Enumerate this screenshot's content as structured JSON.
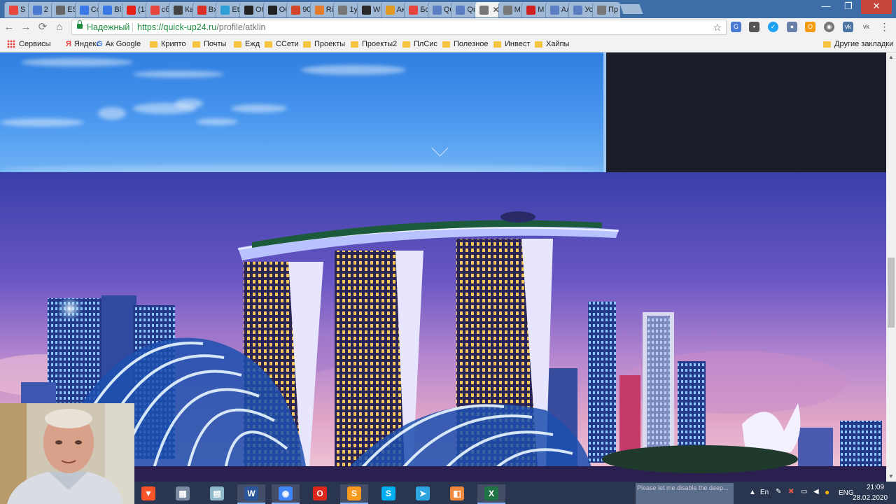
{
  "tabs": [
    {
      "label": "S",
      "icon": "youtube-studio-icon",
      "color": "#e8453c"
    },
    {
      "label": "2",
      "icon": "number-icon",
      "color": "#4a7bd0"
    },
    {
      "label": "ES",
      "icon": "text-icon",
      "color": "#666666"
    },
    {
      "label": "Co",
      "icon": "chat-icon",
      "color": "#3b78e7"
    },
    {
      "label": "Bl",
      "icon": "page-icon",
      "color": "#3b78e7"
    },
    {
      "label": "(13",
      "icon": "youtube-icon",
      "color": "#e62117"
    },
    {
      "label": "сб",
      "icon": "yandex-icon",
      "color": "#e8453c"
    },
    {
      "label": "Ка",
      "icon": "bird-icon",
      "color": "#444444"
    },
    {
      "label": "Вх",
      "icon": "gmail-icon",
      "color": "#d93025"
    },
    {
      "label": "Etl",
      "icon": "wave-icon",
      "color": "#2e9fd8"
    },
    {
      "label": "Об",
      "icon": "bc-icon",
      "color": "#222222"
    },
    {
      "label": "Об",
      "icon": "bc-icon",
      "color": "#222222"
    },
    {
      "label": "90",
      "icon": "mail-icon",
      "color": "#d4462a"
    },
    {
      "label": "Ri",
      "icon": "ring-icon",
      "color": "#e57c2b"
    },
    {
      "label": "1у",
      "icon": "document-icon",
      "color": "#777777"
    },
    {
      "label": "W",
      "icon": "wd-icon",
      "color": "#2b2b2b"
    },
    {
      "label": "Ак",
      "icon": "w-icon",
      "color": "#e39a24"
    },
    {
      "label": "Бо",
      "icon": "candy-icon",
      "color": "#e8453c"
    },
    {
      "label": "Qu",
      "icon": "person-icon",
      "color": "#5b7fc2"
    },
    {
      "label": "Qu",
      "icon": "person-icon",
      "color": "#5b7fc2"
    },
    {
      "label": "",
      "icon": "document-icon",
      "color": "#777777",
      "active": true
    },
    {
      "label": "М",
      "icon": "document-icon",
      "color": "#777777"
    },
    {
      "label": "М",
      "icon": "lp-icon",
      "color": "#d02020"
    },
    {
      "label": "Ал",
      "icon": "person-icon",
      "color": "#5b7fc2"
    },
    {
      "label": "Ус",
      "icon": "person-icon",
      "color": "#5b7fc2"
    },
    {
      "label": "Пр",
      "icon": "document-icon",
      "color": "#777777"
    }
  ],
  "omnibox": {
    "secure_label": "Надежный",
    "url_host": "https://quick-up24.ru",
    "url_path": "/profile/atklin"
  },
  "bookmarks": [
    {
      "label": "Сервисы",
      "icon": "apps-icon"
    },
    {
      "label": "Яндекс",
      "icon": "yandex-icon"
    },
    {
      "label": "Ак Google",
      "icon": "google-icon"
    },
    {
      "label": "Крипто",
      "icon": "folder-icon"
    },
    {
      "label": "Почты",
      "icon": "folder-icon"
    },
    {
      "label": "Ежд",
      "icon": "folder-icon"
    },
    {
      "label": "ССети",
      "icon": "folder-icon"
    },
    {
      "label": "Проекты",
      "icon": "folder-icon"
    },
    {
      "label": "Проекты2",
      "icon": "folder-icon"
    },
    {
      "label": "ПлСис",
      "icon": "folder-icon"
    },
    {
      "label": "Полезное",
      "icon": "folder-icon"
    },
    {
      "label": "Инвест",
      "icon": "folder-icon"
    },
    {
      "label": "Хайпы",
      "icon": "folder-icon"
    }
  ],
  "other_bookmarks": "Другие закладки",
  "taskbar": {
    "apps": [
      {
        "icon": "brave-icon",
        "color": "#fb542b",
        "glyph": "▼"
      },
      {
        "icon": "calculator-icon",
        "color": "#7a8aa0",
        "glyph": "▦"
      },
      {
        "icon": "notes-icon",
        "color": "#8fb8c8",
        "glyph": "▤"
      },
      {
        "icon": "word-icon",
        "color": "#2b579a",
        "glyph": "W",
        "active": true
      },
      {
        "icon": "chrome-icon",
        "color": "#4285f4",
        "glyph": "◉",
        "active": true
      },
      {
        "icon": "opera-icon",
        "color": "#e0251b",
        "glyph": "O"
      },
      {
        "icon": "sublime-icon",
        "color": "#f79a1f",
        "glyph": "S",
        "active": true
      },
      {
        "icon": "skype-icon",
        "color": "#00aff0",
        "glyph": "S"
      },
      {
        "icon": "telegram-icon",
        "color": "#2ca5e0",
        "glyph": "➤"
      },
      {
        "icon": "paint-icon",
        "color": "#f0883e",
        "glyph": "◧"
      },
      {
        "icon": "excel-icon",
        "color": "#217346",
        "glyph": "X",
        "active": true
      }
    ],
    "preview_text": "Please let me disable the deep...",
    "lang_indicator": "En",
    "lang": "ENG",
    "time": "21:09",
    "date": "28.02.2020"
  }
}
